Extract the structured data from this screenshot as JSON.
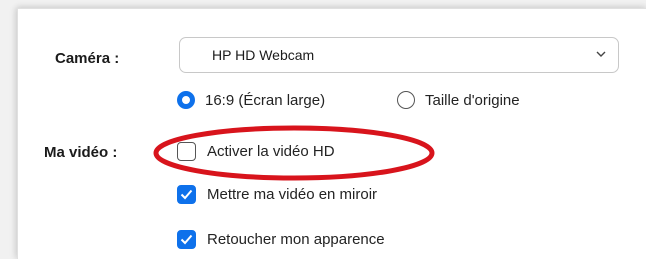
{
  "settings": {
    "camera": {
      "label": "Caméra :",
      "selected": "HP HD Webcam",
      "dropdown_icon": "chevron-down-icon"
    },
    "aspect_ratio": {
      "options": [
        {
          "label": "16:9 (Écran large)",
          "selected": true
        },
        {
          "label": "Taille d'origine",
          "selected": false
        }
      ]
    },
    "my_video": {
      "label": "Ma vidéo :",
      "checkboxes": [
        {
          "label": "Activer la vidéo HD",
          "checked": false
        },
        {
          "label": "Mettre ma vidéo en miroir",
          "checked": true
        },
        {
          "label": "Retoucher mon apparence",
          "checked": true
        }
      ]
    }
  },
  "annotation": {
    "shape": "ellipse",
    "color": "#d8141c"
  },
  "colors": {
    "accent": "#0e71eb"
  }
}
